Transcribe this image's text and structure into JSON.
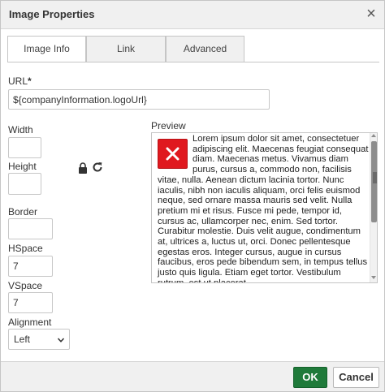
{
  "dialog": {
    "title": "Image Properties",
    "close_glyph": "×"
  },
  "tabs": [
    {
      "label": "Image Info",
      "active": true
    },
    {
      "label": "Link",
      "active": false
    },
    {
      "label": "Advanced",
      "active": false
    }
  ],
  "url": {
    "label": "URL",
    "required_mark": "*",
    "value": "${companyInformation.logoUrl}"
  },
  "fields": {
    "width": {
      "label": "Width",
      "value": ""
    },
    "height": {
      "label": "Height",
      "value": ""
    },
    "border": {
      "label": "Border",
      "value": ""
    },
    "hspace": {
      "label": "HSpace",
      "value": "7"
    },
    "vspace": {
      "label": "VSpace",
      "value": "7"
    },
    "alignment": {
      "label": "Alignment",
      "value": "Left"
    }
  },
  "icons": {
    "lock": "lock-icon",
    "reset": "reset-size-icon",
    "broken_image": "broken-image-icon"
  },
  "preview": {
    "label": "Preview",
    "text": "Lorem ipsum dolor sit amet, consectetuer adipiscing elit. Maecenas feugiat consequat diam. Maecenas metus. Vivamus diam purus, cursus a, commodo non, facilisis vitae, nulla. Aenean dictum lacinia tortor. Nunc iaculis, nibh non iaculis aliquam, orci felis euismod neque, sed ornare massa mauris sed velit. Nulla pretium mi et risus. Fusce mi pede, tempor id, cursus ac, ullamcorper nec, enim. Sed tortor. Curabitur molestie. Duis velit augue, condimentum at, ultrices a, luctus ut, orci. Donec pellentesque egestas eros. Integer cursus, augue in cursus faucibus, eros pede bibendum sem, in tempus tellus justo quis ligula. Etiam eget tortor. Vestibulum rutrum, est ut placerat"
  },
  "buttons": {
    "ok": "OK",
    "cancel": "Cancel"
  },
  "colors": {
    "ok_green": "#1f7a3a",
    "broken_red": "#e0191f"
  }
}
